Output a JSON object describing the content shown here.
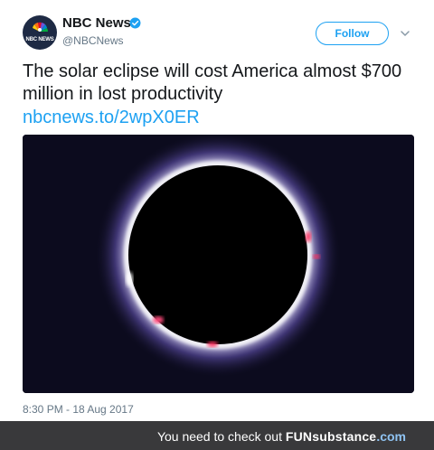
{
  "account": {
    "display_name": "NBC News",
    "handle": "@NBCNews",
    "avatar_text": "NBC NEWS",
    "verified": true
  },
  "actions": {
    "follow_label": "Follow"
  },
  "tweet": {
    "text": "The solar eclipse will cost America almost $700 million in lost productivity",
    "link": "nbcnews.to/2wpX0ER",
    "timestamp": "8:30 PM - 18 Aug 2017"
  },
  "banner": {
    "prefix": "You need to check out ",
    "brand_main": "FUN",
    "brand_rest": "substance",
    "brand_tld": ".com"
  },
  "colors": {
    "accent": "#1da1f2",
    "banner_bg": "#39393b",
    "media_bg": "#0c0b1e"
  },
  "icons": {
    "verified": "verified-badge-icon",
    "caret": "chevron-down-icon",
    "logo": "nbc-peacock-logo"
  }
}
